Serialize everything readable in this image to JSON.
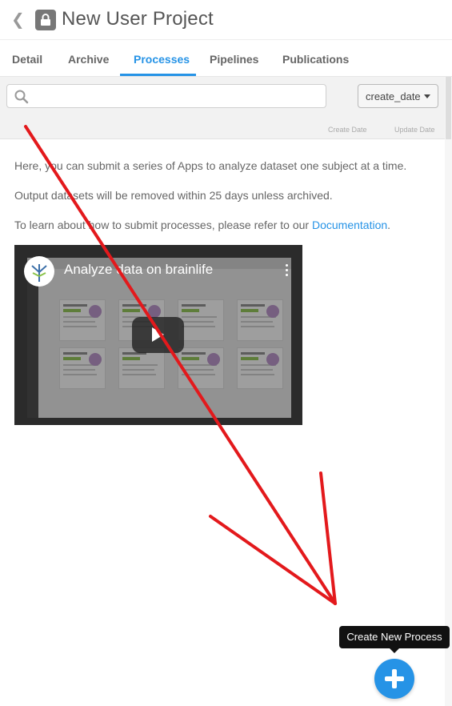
{
  "header": {
    "back_icon": "chevron-left-icon",
    "lock_icon": "lock-icon",
    "title": "New User Project"
  },
  "tabs": [
    {
      "label": "Detail",
      "active": false
    },
    {
      "label": "Archive",
      "active": false
    },
    {
      "label": "Processes",
      "active": true
    },
    {
      "label": "Pipelines",
      "active": false
    },
    {
      "label": "Publications",
      "active": false
    }
  ],
  "toolbar": {
    "search_icon": "search-icon",
    "search_value": "",
    "search_placeholder": "",
    "sort_value": "create_date",
    "columns": [
      "Create Date",
      "Update Date"
    ]
  },
  "content": {
    "line1": "Here, you can submit a series of Apps to analyze dataset one subject at a time.",
    "line2": "Output datasets will be removed within 25 days unless archived.",
    "line3_prefix": "To learn about how to submit processes, please refer to our ",
    "line3_link": "Documentation",
    "line3_suffix": "."
  },
  "video": {
    "title": "Analyze data on brainlife"
  },
  "tooltip": {
    "text": "Create New Process"
  },
  "fab": {
    "icon": "plus-icon"
  },
  "colors": {
    "accent": "#2693e6",
    "annotation": "#e3191c"
  }
}
